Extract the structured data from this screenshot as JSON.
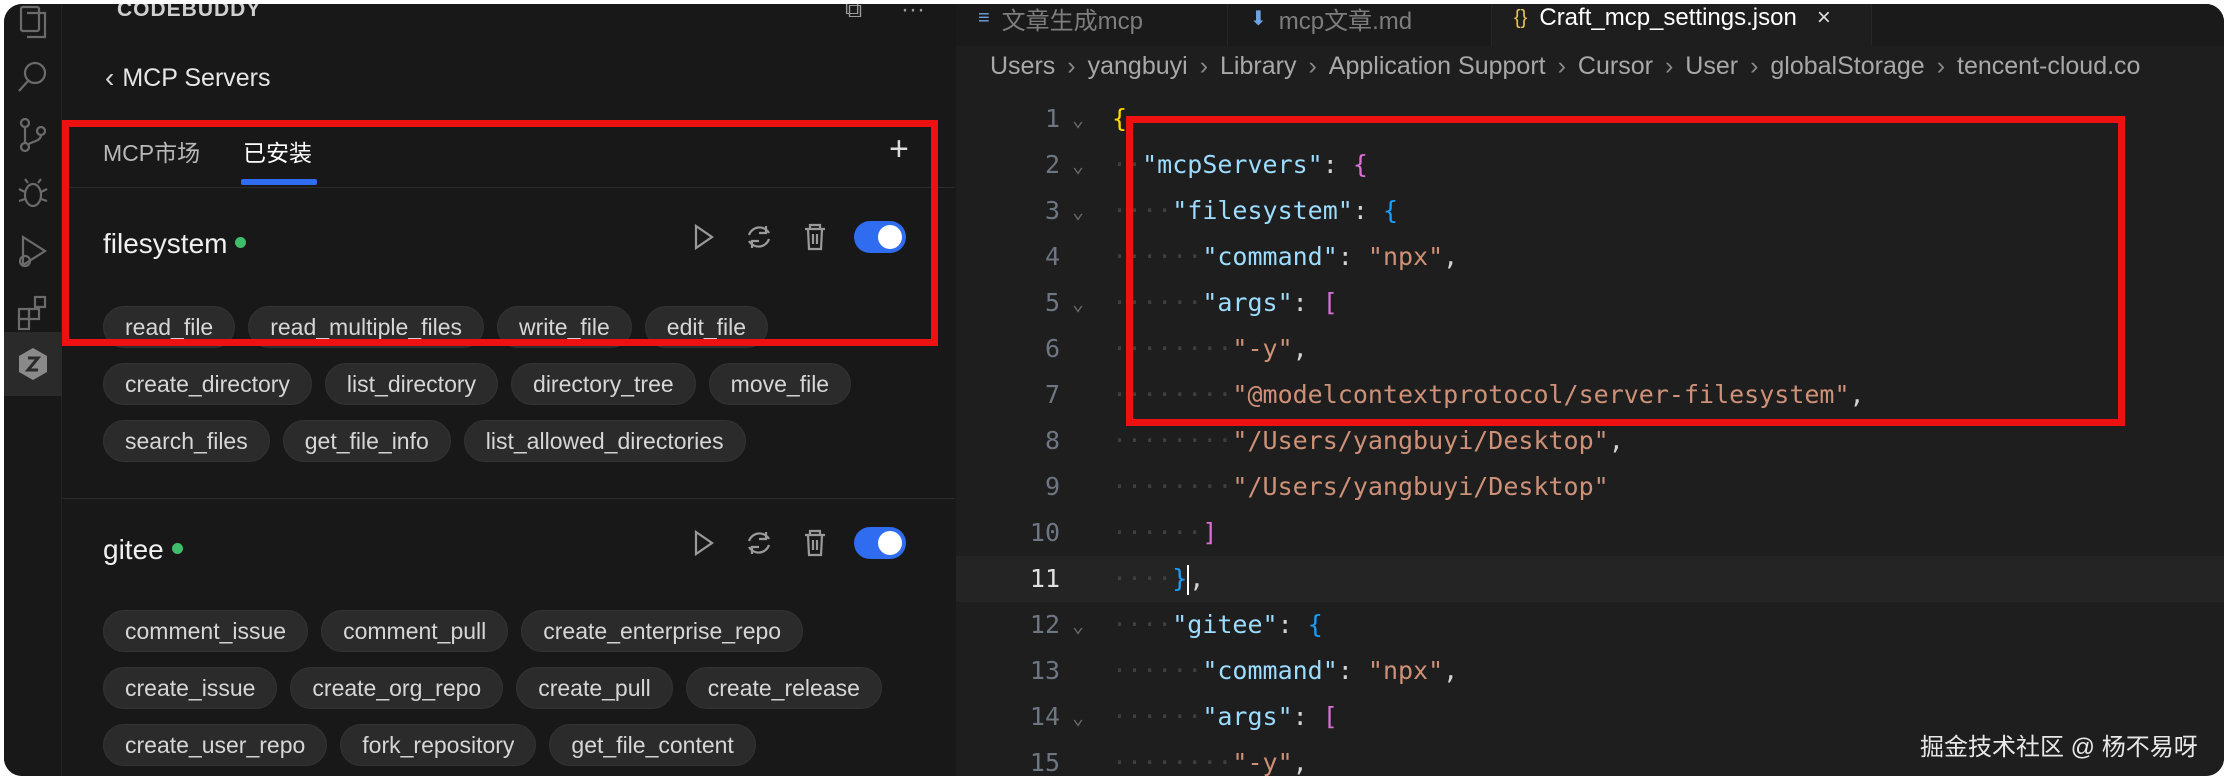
{
  "sidebar": {
    "title": "CODEBUDDY",
    "back_label": "MCP Servers",
    "tabs": [
      "MCP市场",
      "已安装"
    ],
    "active_tab": "已安装",
    "add_label": "+"
  },
  "servers": [
    {
      "name": "filesystem",
      "status": "running",
      "enabled": true,
      "tools": [
        "read_file",
        "read_multiple_files",
        "write_file",
        "edit_file",
        "create_directory",
        "list_directory",
        "directory_tree",
        "move_file",
        "search_files",
        "get_file_info",
        "list_allowed_directories"
      ]
    },
    {
      "name": "gitee",
      "status": "running",
      "enabled": true,
      "tools": [
        "comment_issue",
        "comment_pull",
        "create_enterprise_repo",
        "create_issue",
        "create_org_repo",
        "create_pull",
        "create_release",
        "create_user_repo",
        "fork_repository",
        "get_file_content"
      ]
    }
  ],
  "editor": {
    "tabs": [
      {
        "label": "文章生成mcp",
        "icon": "list-icon"
      },
      {
        "label": "mcp文章.md",
        "icon": "markdown-icon"
      },
      {
        "label": "Craft_mcp_settings.json",
        "icon": "json-icon",
        "active": true,
        "close": "×"
      }
    ],
    "breadcrumb": [
      "Users",
      "yangbuyi",
      "Library",
      "Application Support",
      "Cursor",
      "User",
      "globalStorage",
      "tencent-cloud.co"
    ],
    "current_line": 11,
    "lines": [
      {
        "n": "1",
        "text": "{"
      },
      {
        "n": "2",
        "text": "\"mcpServers\": {"
      },
      {
        "n": "3",
        "text": "\"filesystem\": {"
      },
      {
        "n": "4",
        "text": "\"command\": \"npx\","
      },
      {
        "n": "5",
        "text": "\"args\": ["
      },
      {
        "n": "6",
        "text": "\"-y\","
      },
      {
        "n": "7",
        "text": "\"@modelcontextprotocol/server-filesystem\","
      },
      {
        "n": "8",
        "text": "\"/Users/yangbuyi/Desktop\","
      },
      {
        "n": "9",
        "text": "\"/Users/yangbuyi/Desktop\""
      },
      {
        "n": "10",
        "text": "]"
      },
      {
        "n": "11",
        "text": "},"
      },
      {
        "n": "12",
        "text": "\"gitee\": {"
      },
      {
        "n": "13",
        "text": "\"command\": \"npx\","
      },
      {
        "n": "14",
        "text": "\"args\": ["
      },
      {
        "n": "15",
        "text": "\"-y\","
      }
    ]
  },
  "watermark": "掘金技术社区 @ 杨不易呀",
  "colors": {
    "accent": "#2f6cf0",
    "status": "#3fbd6a",
    "highlight": "#ee1111"
  }
}
